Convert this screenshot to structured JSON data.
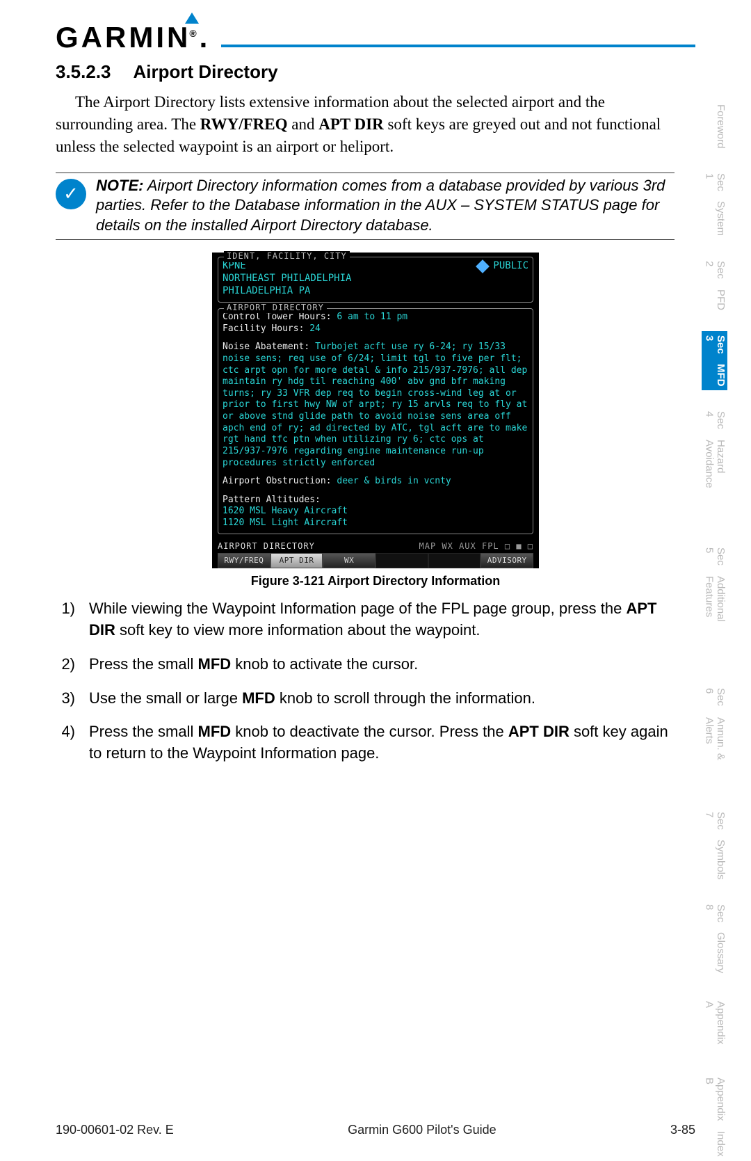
{
  "brand": "GARMIN",
  "heading_num": "3.5.2.3",
  "heading_title": "Airport Directory",
  "intro_html": "The Airport Directory lists extensive information about the selected airport and the surrounding area. The <b>RWY/FREQ</b> and <b>APT DIR</b> soft keys are greyed out and not functional unless the selected waypoint is an airport or heliport.",
  "note_label": "NOTE:",
  "note_body": "Airport Directory information comes from a database provided by various 3rd parties.  Refer to the Database information in the  AUX – SYSTEM STATUS page for details on the installed Airport Directory database.",
  "screen": {
    "ident_legend": "IDENT, FACILITY, CITY",
    "ident": "KPNE",
    "public": "PUBLIC",
    "facility": "NORTHEAST PHILADELPHIA",
    "city": "PHILADELPHIA PA",
    "dir_legend": "AIRPORT DIRECTORY",
    "tower_label": "Control Tower Hours:",
    "tower_val": "6 am to 11 pm",
    "fac_label": "Facility Hours:",
    "fac_val": "24",
    "noise_label": "Noise Abatement:",
    "noise_val": "Turbojet acft use ry 6-24; ry 15/33 noise sens; req use of 6/24; limit tgl to five per flt; ctc arpt opn for more detal & info 215/937-7976; all dep maintain ry hdg til reaching 400' abv gnd bfr making turns; ry 33 VFR dep req to begin cross-wind leg at or prior to first hwy NW of arpt; ry 15 arvls req to fly at or above stnd glide path to avoid noise sens area off apch end of ry; ad directed by ATC, tgl acft are to make rgt hand tfc ptn when utilizing ry 6; ctc ops at 215/937-7976 regarding engine maintenance run-up procedures strictly enforced",
    "obs_label": "Airport Obstruction:",
    "obs_val": "deer & birds in vcnty",
    "pat_label": "Pattern Altitudes:",
    "pat_1": "1620 MSL Heavy Aircraft",
    "pat_2": "1120 MSL Light Aircraft",
    "foot_left": "AIRPORT DIRECTORY",
    "foot_right": "MAP WX AUX FPL  □ ■ □",
    "tabs": [
      "RWY/FREQ",
      "APT DIR",
      "WX",
      "",
      "",
      "ADVISORY"
    ]
  },
  "fig_caption": "Figure 3-121  Airport Directory Information",
  "steps": [
    "While viewing the Waypoint Information page of the FPL page group, press the <b>APT DIR</b> soft key to view more information about the waypoint.",
    "Press the small  <b>MFD</b> knob to activate the cursor.",
    "Use the small or large <b>MFD</b> knob to scroll through the information.",
    "Press the small  <b>MFD</b> knob to deactivate the cursor. Press the <b>APT DIR</b> soft key again to return to the Waypoint Information page."
  ],
  "footer": {
    "left": "190-00601-02  Rev. E",
    "center": "Garmin G600 Pilot's Guide",
    "right": "3-85"
  },
  "side_tabs": [
    {
      "t1": "",
      "t2": "Foreword",
      "active": false
    },
    {
      "t1": "Sec 1",
      "t2": "System",
      "active": false
    },
    {
      "t1": "Sec 2",
      "t2": "PFD",
      "active": false
    },
    {
      "t1": "Sec 3",
      "t2": "MFD",
      "active": true
    },
    {
      "t1": "Sec 4",
      "t2": "Hazard Avoidance",
      "active": false
    },
    {
      "t1": "Sec 5",
      "t2": "Additional Features",
      "active": false
    },
    {
      "t1": "Sec 6",
      "t2": "Annun. & Alerts",
      "active": false
    },
    {
      "t1": "Sec 7",
      "t2": "Symbols",
      "active": false
    },
    {
      "t1": "Sec 8",
      "t2": "Glossary",
      "active": false
    },
    {
      "t1": "",
      "t2": "Appendix A",
      "active": false
    },
    {
      "t1": "Appendix B",
      "t2": "Index",
      "active": false
    }
  ]
}
